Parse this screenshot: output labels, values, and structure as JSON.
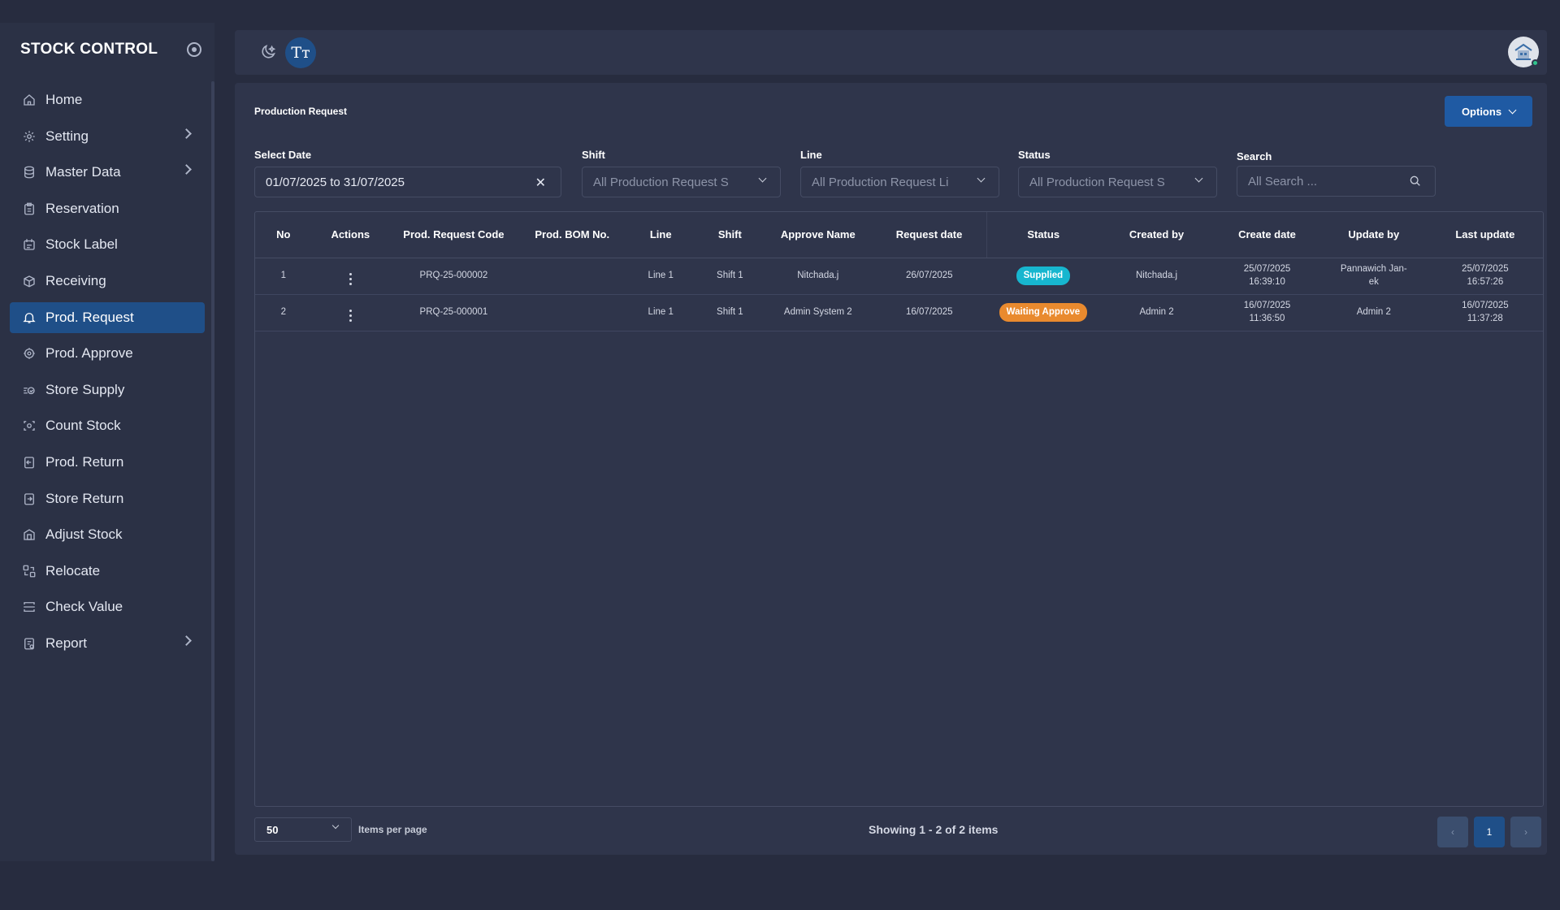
{
  "sidebar": {
    "brand": "STOCK CONTROL",
    "items": [
      {
        "label": "Home",
        "icon": "home-icon",
        "chevron": false,
        "active": false
      },
      {
        "label": "Setting",
        "icon": "gear-icon",
        "chevron": true,
        "active": false
      },
      {
        "label": "Master Data",
        "icon": "database-icon",
        "chevron": true,
        "active": false
      },
      {
        "label": "Reservation",
        "icon": "clipboard-icon",
        "chevron": false,
        "active": false
      },
      {
        "label": "Stock Label",
        "icon": "label-icon",
        "chevron": false,
        "active": false
      },
      {
        "label": "Receiving",
        "icon": "box-icon",
        "chevron": false,
        "active": false
      },
      {
        "label": "Prod. Request",
        "icon": "bell-icon",
        "chevron": true,
        "active": true
      },
      {
        "label": "Prod. Approve",
        "icon": "gear-check-icon",
        "chevron": false,
        "active": false
      },
      {
        "label": "Store Supply",
        "icon": "supply-icon",
        "chevron": false,
        "active": false
      },
      {
        "label": "Count Stock",
        "icon": "scan-icon",
        "chevron": false,
        "active": false
      },
      {
        "label": "Prod. Return",
        "icon": "return-icon",
        "chevron": false,
        "active": false
      },
      {
        "label": "Store Return",
        "icon": "store-return-icon",
        "chevron": false,
        "active": false
      },
      {
        "label": "Adjust Stock",
        "icon": "adjust-icon",
        "chevron": false,
        "active": false
      },
      {
        "label": "Relocate",
        "icon": "relocate-icon",
        "chevron": false,
        "active": false
      },
      {
        "label": "Check Value",
        "icon": "check-value-icon",
        "chevron": false,
        "active": false
      },
      {
        "label": "Report",
        "icon": "report-icon",
        "chevron": true,
        "active": false
      }
    ]
  },
  "topbar": {
    "font_size_label": "Tт"
  },
  "page": {
    "title": "Production Request",
    "options_label": "Options"
  },
  "filters": {
    "date_label": "Select Date",
    "date_value": "01/07/2025 to 31/07/2025",
    "shift_label": "Shift",
    "shift_placeholder": "All Production Request S",
    "line_label": "Line",
    "line_placeholder": "All Production Request Li",
    "status_label": "Status",
    "status_placeholder": "All Production Request S",
    "search_label": "Search",
    "search_placeholder": "All Search ..."
  },
  "table": {
    "columns": [
      "No",
      "Actions",
      "Prod. Request Code",
      "Prod. BOM No.",
      "Line",
      "Shift",
      "Approve Name",
      "Request date",
      "Status",
      "Created by",
      "Create date",
      "Update by",
      "Last update"
    ],
    "rows": [
      {
        "no": "1",
        "code": "PRQ-25-000002",
        "bom": "",
        "line": "Line 1",
        "shift": "Shift 1",
        "approve_name": "Nitchada.j",
        "request_date": "26/07/2025",
        "status": "Supplied",
        "status_color": "#17b6cf",
        "created_by": "Nitchada.j",
        "create_date_1": "25/07/2025",
        "create_date_2": "16:39:10",
        "update_by_1": "Pannawich Jan-",
        "update_by_2": "ek",
        "last_update_1": "25/07/2025",
        "last_update_2": "16:57:26"
      },
      {
        "no": "2",
        "code": "PRQ-25-000001",
        "bom": "",
        "line": "Line 1",
        "shift": "Shift 1",
        "approve_name": "Admin System 2",
        "request_date": "16/07/2025",
        "status": "Waiting Approve",
        "status_color": "#e98a2e",
        "created_by": "Admin 2",
        "create_date_1": "16/07/2025",
        "create_date_2": "11:36:50",
        "update_by_1": "Admin 2",
        "update_by_2": "",
        "last_update_1": "16/07/2025",
        "last_update_2": "11:37:28"
      }
    ]
  },
  "footer": {
    "per_page": "50",
    "per_page_label": "Items per page",
    "showing": "Showing 1 - 2 of 2 items",
    "current_page": "1"
  }
}
